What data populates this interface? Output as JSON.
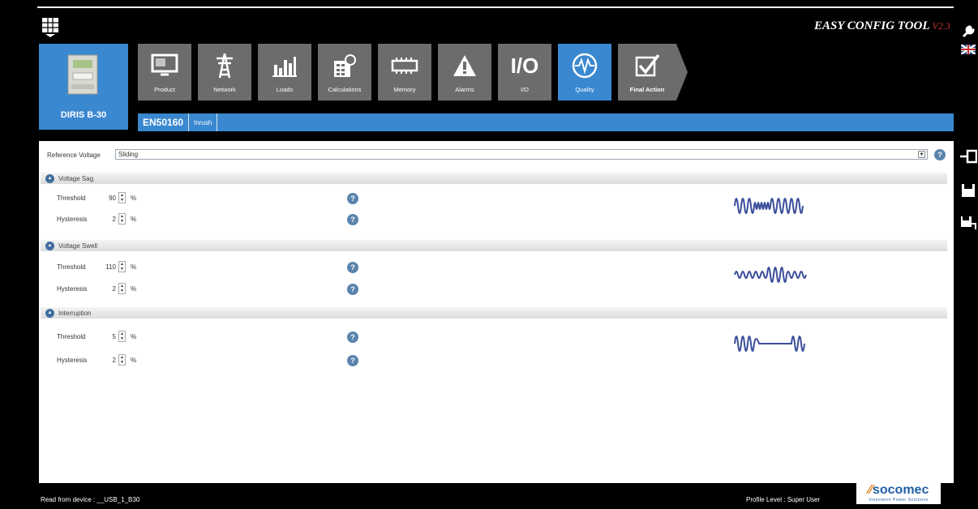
{
  "app": {
    "title": "EASY CONFIG TOOL",
    "version": "V2.3"
  },
  "device": {
    "name": "DIRIS B-30"
  },
  "tabs": [
    {
      "label": "Product",
      "icon": "monitor-icon",
      "active": false
    },
    {
      "label": "Network",
      "icon": "pylon-icon",
      "active": false
    },
    {
      "label": "Loads",
      "icon": "loads-chart-icon",
      "active": false
    },
    {
      "label": "Calculations",
      "icon": "calculator-icon",
      "active": false
    },
    {
      "label": "Memory",
      "icon": "memory-chip-icon",
      "active": false
    },
    {
      "label": "Alarms",
      "icon": "warning-triangle-icon",
      "active": false
    },
    {
      "label": "I/O",
      "icon": "io-icon",
      "active": false
    },
    {
      "label": "Quality",
      "icon": "waveform-circle-icon",
      "active": true
    },
    {
      "label": "Final Action",
      "icon": "checkbox-icon",
      "active": false
    }
  ],
  "subtabs": [
    {
      "label": "EN50160",
      "active": true
    },
    {
      "label": "Inrush",
      "active": false
    }
  ],
  "reference_voltage": {
    "label": "Reference Voltage",
    "value": "Sliding"
  },
  "sections": {
    "sag": {
      "title": "Voltage Sag",
      "threshold_label": "Threshold",
      "threshold_value": "90",
      "hysteresis_label": "Hysteresis",
      "hysteresis_value": "2",
      "unit": "%"
    },
    "swell": {
      "title": "Voltage Swell",
      "threshold_label": "Threshold",
      "threshold_value": "110",
      "hysteresis_label": "Hysteresis",
      "hysteresis_value": "2",
      "unit": "%"
    },
    "interruption": {
      "title": "Interruption",
      "threshold_label": "Threshold",
      "threshold_value": "5",
      "hysteresis_label": "Hysteresis",
      "hysteresis_value": "2",
      "unit": "%"
    }
  },
  "status": {
    "read_from": "Read from device : __USB_1_B30",
    "profile": "Profile Level : Super User"
  },
  "brand": {
    "name": "socomec",
    "tagline": "Innovative Power Solutions"
  },
  "colors": {
    "accent": "#3a88d0",
    "tab_inactive": "#6c6c6c",
    "version_red": "#c8322d",
    "waveform": "#3c4f9c"
  }
}
